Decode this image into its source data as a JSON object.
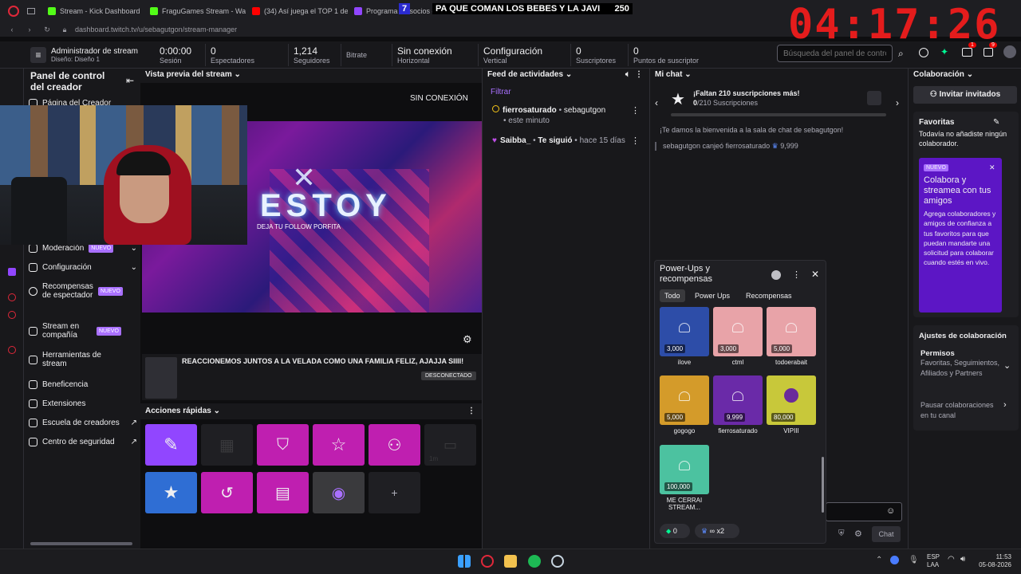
{
  "browser": {
    "tabs": [
      "Stream - Kick Dashboard",
      "FraguGames Stream - Watc",
      "(34) Así juega el TOP 1 del",
      "Programa de socios de"
    ],
    "url": "dashboard.twitch.tv/u/sebagutgon/stream-manager",
    "tab_fav_colors": [
      "#53fc18",
      "#53fc18",
      "#ff0000",
      "#9146ff"
    ]
  },
  "overlay": {
    "banner": "PA QUE COMAN LOS BEBES Y LA JAVI",
    "count": "250",
    "num": "7",
    "timer": "04:17:26"
  },
  "topbar": {
    "role": "Administrador de stream",
    "layout": "Diseño: Diseño 1",
    "stats": [
      {
        "value": "0:00:00",
        "label": "Sesión"
      },
      {
        "value": "0",
        "label": "Espectadores"
      },
      {
        "value": "1,214",
        "label": "Seguidores"
      },
      {
        "value": "",
        "label": "Bitrate"
      },
      {
        "value": "Sin conexión",
        "label": "Horizontal"
      },
      {
        "value": "Configuración",
        "label": "Vertical"
      },
      {
        "value": "0",
        "label": "Suscriptores"
      },
      {
        "value": "0",
        "label": "Puntos de suscriptor"
      }
    ],
    "search_placeholder": "Búsqueda del panel de control",
    "notif_a": "1",
    "notif_b": "9"
  },
  "sidebar": {
    "title": "Panel de control del creador",
    "items": [
      {
        "label": "Página del Creador"
      },
      {
        "label": "Moderación",
        "badge": "NUEVO"
      },
      {
        "label": "Configuración"
      },
      {
        "label": "Recompensas de espectador",
        "badge": "NUEVO"
      },
      {
        "label": "Stream en compañía",
        "badge": "NUEVO"
      },
      {
        "label": "Herramientas de stream"
      },
      {
        "label": "Beneficencia"
      },
      {
        "label": "Extensiones"
      },
      {
        "label": "Escuela de creadores"
      },
      {
        "label": "Centro de seguridad"
      }
    ]
  },
  "preview": {
    "header": "Vista previa del stream",
    "offline": "SIN CONEXIÓN",
    "video_title": "ESTOY",
    "video_sub": "DEJA TU FOLLOW PORFITA",
    "stream_title": "REACCIONEMOS JUNTOS A LA VELADA COMO UNA FAMILIA FELIZ, AJAJJA SIIII!",
    "status": "DESCONECTADO"
  },
  "quick_actions": {
    "header": "Acciones rápidas",
    "timer_label": "1m",
    "add": "+"
  },
  "feed": {
    "header": "Feed de actividades",
    "filter": "Filtrar",
    "items": [
      {
        "user": "fierrosaturado",
        "sep": " • ",
        "target": "sebagutgon",
        "time": "• este minuto"
      },
      {
        "user": "Saibba_",
        "sep": " • ",
        "action": "Te siguió",
        "time": "• hace 15 días"
      }
    ]
  },
  "chat": {
    "header": "Mi chat",
    "goal_title": "¡Faltan 210 suscripciones más!",
    "goal_count": "0",
    "goal_total": "/210 Suscripciones",
    "welcome": "¡Te damos la bienvenida a la sala de chat de sebagutgon!",
    "redeem": "sebagutgon canjeó fierrosaturado",
    "redeem_amount": "9,999",
    "chat_button": "Chat",
    "bits_count": "0",
    "multiplier": "x2"
  },
  "powerups": {
    "title": "Power-Ups y recompensas",
    "tabs": [
      "Todo",
      "Power Ups",
      "Recompensas"
    ],
    "rewards": [
      {
        "name": "ilove",
        "cost": "3,000",
        "color": "#2d4da8"
      },
      {
        "name": "ctml",
        "cost": "3,000",
        "color": "#e8a3a8"
      },
      {
        "name": "todoerabait",
        "cost": "5,000",
        "color": "#e8a3a8"
      },
      {
        "name": "gogogo",
        "cost": "5,000",
        "color": "#d49b2a"
      },
      {
        "name": "fierrosaturado",
        "cost": "9,999",
        "color": "#6a2aa8"
      },
      {
        "name": "VIPIII",
        "cost": "80,000",
        "color": "#c8c83a"
      },
      {
        "name": "ME CERRAI STREAM...",
        "cost": "100,000",
        "color": "#4cc2a0"
      }
    ]
  },
  "collab": {
    "header": "Colaboración",
    "invite": "Invitar invitados",
    "fav_title": "Favoritas",
    "fav_text": "Todavía no añadiste ningún colaborador.",
    "promo_badge": "NUEVO",
    "promo_title": "Colabora y streamea con tus amigos",
    "promo_text": "Agrega colaboradores y amigos de confianza a tus favoritos para que puedan mandarte una solicitud para colaborar cuando estés en vivo.",
    "settings_title": "Ajustes de colaboración",
    "perm_title": "Permisos",
    "perm_text": "Favoritas, Seguimientos, Afiliados y Partners",
    "pause_text": "Pausar colaboraciones en tu canal"
  },
  "taskbar": {
    "lang1": "ESP",
    "lang2": "LAA",
    "time": "11:53",
    "date": "05-08-2026"
  }
}
